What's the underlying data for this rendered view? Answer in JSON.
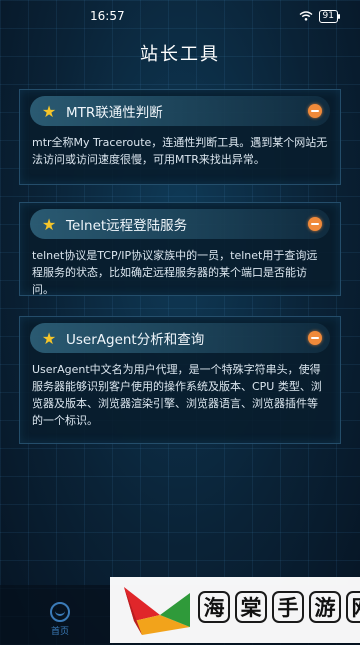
{
  "status_bar": {
    "time": "16:57",
    "battery": "91"
  },
  "page": {
    "title": "站长工具"
  },
  "cards": [
    {
      "title": "MTR联通性判断",
      "description": "mtr全称My Traceroute，连通性判断工具。遇到某个网站无法访问或访问速度很慢，可用MTR来找出异常。"
    },
    {
      "title": "Telnet远程登陆服务",
      "description": "telnet协议是TCP/IP协议家族中的一员，telnet用于查询远程服务的状态，比如确定远程服务器的某个端口是否能访问。"
    },
    {
      "title": "UserAgent分析和查询",
      "description": "UserAgent中文名为用户代理，是一个特殊字符串头，使得服务器能够识别客户使用的操作系统及版本、CPU 类型、浏览器及版本、浏览器渲染引擎、浏览器语言、浏览器插件等的一个标识。"
    }
  ],
  "tab_bar": {
    "home_label": "首页"
  },
  "watermark": {
    "chars": [
      "海",
      "棠",
      "手",
      "游",
      "网"
    ]
  },
  "colors": {
    "accent": "#f5c52a",
    "toggle": "#f08a3a",
    "tab": "#3b7bb8",
    "background": "#0a2236"
  },
  "icons": {
    "card_lead": "star-icon",
    "card_action": "toggle-icon",
    "tab_home": "home-icon"
  }
}
